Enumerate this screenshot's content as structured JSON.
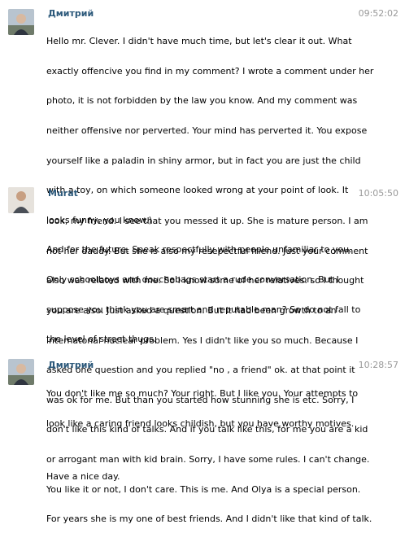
{
  "messages": [
    {
      "author": "Дмитрий",
      "avatar": "avatar-dmitry",
      "time": "09:52:02",
      "lines": [
        "Hello mr. Clever. I didn't have much time, but let's clear it out. What",
        "exactly offencive you find in my comment? I wrote a comment under her",
        "photo, it is not forbidden by the law you know. And my comment was",
        "neither offensive nor perverted. Your mind has perverted it. You expose",
        "yourself like a paladin in shiny armor, but in fact you are just the child",
        "with a toy, on which someone looked wrong at your point of look. It",
        "looks funny, you know.)",
        "And for the future. Speak respectfully with people unfamiliar to you.",
        "Only schoolboys and douchebags start a rude conversation. But I",
        "suppose you think you are smart and reputable man? So do not fall to",
        "the level of street thugs."
      ]
    },
    {
      "author": "Murat",
      "avatar": "avatar-murat",
      "time": "10:05:50",
      "lines": [
        "look, my friend. I see that you messed it up. She is mature person. I am",
        "not her daddy. But she is also my resepectful friend. Just your comment",
        "also was related with me. So I know some of her relatives. so I thought",
        "you are also. Just asked a question. But it had been growth to an",
        "internatonal nuclear problem. Yes I didn't like you so much. Because I",
        "asked one question and you replied \"no , a friend\" ok. at that point it",
        "was ok for me. But than you started how stunning she is etc. Sorry, I",
        "don't like this kind of talks. And if you talk like this, for me you are a kid",
        "or arrogant man with kid brain. Sorry, I have some rules. I can't change.",
        "You like it or not, I don't care. This is me. And Olya is a special person.",
        "For years she is my one of best friends. And I didn't like that kind of talk."
      ]
    },
    {
      "author": "Дмитрий",
      "avatar": "avatar-dmitry",
      "time": "10:28:57",
      "lines": [
        "You don't like me so much? Your right. But I like you. Your attempts to",
        "look like a caring friend looks childish, but you have worthy motives."
      ],
      "extra": "Have a nice day."
    }
  ]
}
